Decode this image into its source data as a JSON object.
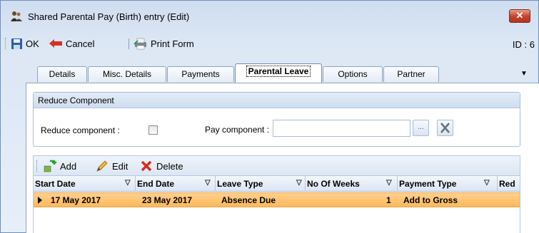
{
  "window": {
    "title": "Shared Parental Pay (Birth) entry (Edit)",
    "close_label": "✕",
    "id_label": "ID : 6"
  },
  "toolbar": {
    "ok_label": "OK",
    "cancel_label": "Cancel",
    "print_label": "Print Form"
  },
  "tabs": [
    {
      "label": "Details",
      "active": false
    },
    {
      "label": "Misc. Details",
      "active": false
    },
    {
      "label": "Payments",
      "active": false
    },
    {
      "label": "Parental Leave",
      "active": true
    },
    {
      "label": "Options",
      "active": false
    },
    {
      "label": "Partner",
      "active": false
    }
  ],
  "reduce_group": {
    "header": "Reduce Component",
    "reduce_label": "Reduce component :",
    "reduce_checked": false,
    "pay_label": "Pay component :",
    "pay_value": "",
    "ellipsis_label": "..."
  },
  "grid_toolbar": {
    "add_label": "Add",
    "edit_label": "Edit",
    "delete_label": "Delete"
  },
  "grid": {
    "columns": [
      "Start Date",
      "End Date",
      "Leave Type",
      "No Of Weeks",
      "Payment Type",
      "Red"
    ],
    "rows": [
      {
        "start": "17 May 2017",
        "end": "23 May 2017",
        "leave_type": "Absence Due",
        "weeks": "1",
        "payment_type": "Add to Gross",
        "red": ""
      }
    ]
  },
  "colors": {
    "selected_row": "#ffc070",
    "panel_border": "#8ea4c1",
    "delete_red": "#d42b1e",
    "add_green": "#2e9b3a"
  }
}
